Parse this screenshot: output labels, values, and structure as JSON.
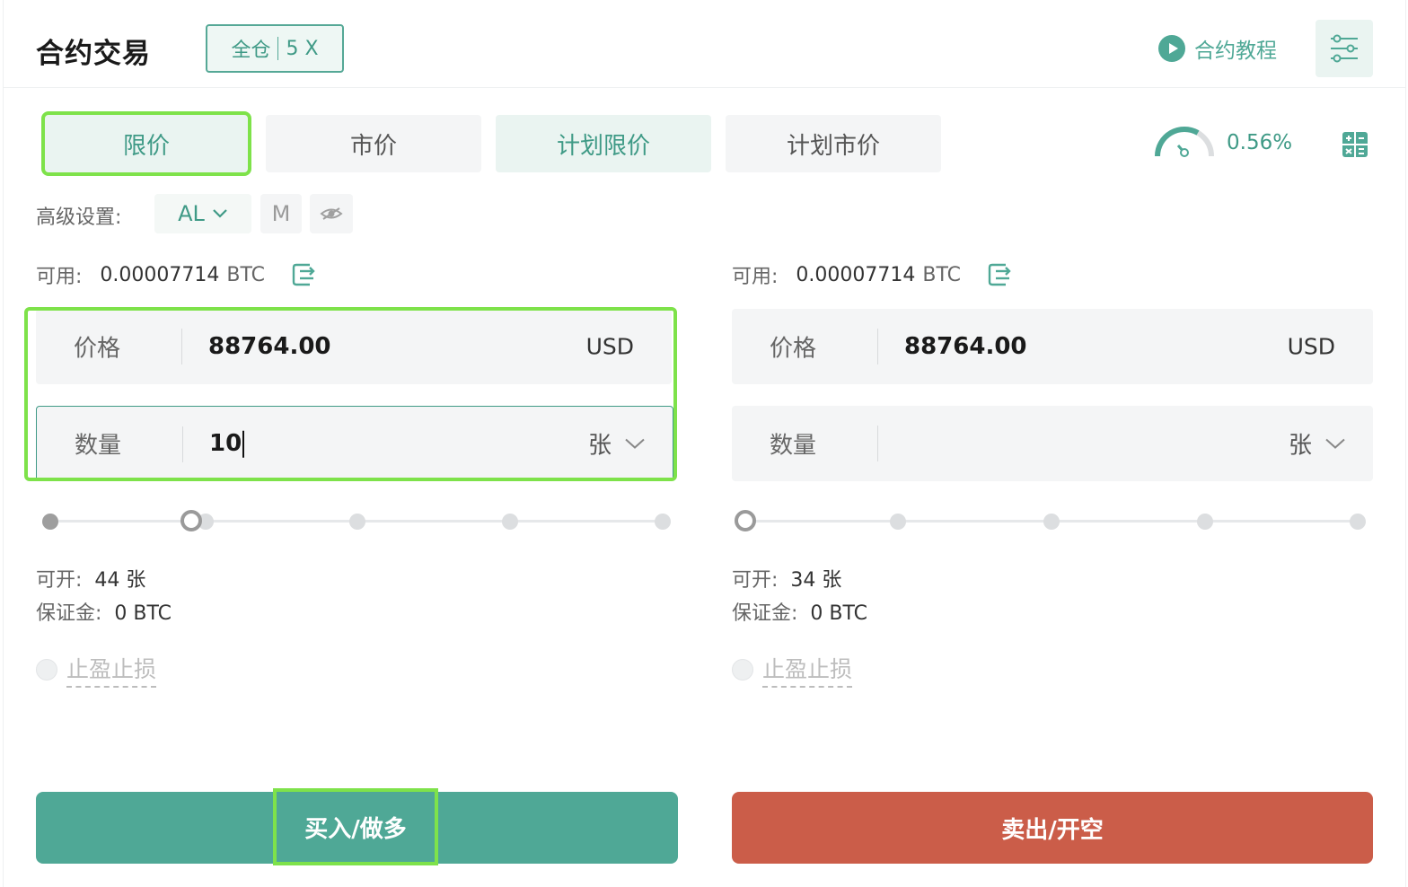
{
  "header": {
    "title": "合约交易",
    "margin_mode": "全仓",
    "leverage": "5 X",
    "tutorial_label": "合约教程"
  },
  "order_tabs": [
    {
      "label": "限价",
      "active": true
    },
    {
      "label": "市价",
      "active": false
    },
    {
      "label": "计划限价",
      "active": false
    },
    {
      "label": "计划市价",
      "active": false
    }
  ],
  "fee_gauge": {
    "value": "0.56%"
  },
  "advanced": {
    "label": "高级设置:",
    "al_label": "AL",
    "m_label": "M"
  },
  "buy_side": {
    "available_label": "可用:",
    "available_value": "0.00007714",
    "available_unit": "BTC",
    "price_label": "价格",
    "price_value": "88764.00",
    "price_unit": "USD",
    "qty_label": "数量",
    "qty_value": "10",
    "qty_unit": "张",
    "slider_level": 0.25,
    "can_open_label": "可开:",
    "can_open_value": "44 张",
    "margin_label": "保证金:",
    "margin_value": "0 BTC",
    "tpsl_label": "止盈止损",
    "button_label": "买入/做多"
  },
  "sell_side": {
    "available_label": "可用:",
    "available_value": "0.00007714",
    "available_unit": "BTC",
    "price_label": "价格",
    "price_value": "88764.00",
    "price_unit": "USD",
    "qty_label": "数量",
    "qty_value": "",
    "qty_unit": "张",
    "slider_level": 0,
    "can_open_label": "可开:",
    "can_open_value": "34 张",
    "margin_label": "保证金:",
    "margin_value": "0 BTC",
    "tpsl_label": "止盈止损",
    "button_label": "卖出/开空"
  },
  "colors": {
    "accent": "#4fa896",
    "buy": "#4fa896",
    "sell": "#cb5d49",
    "highlight": "#7ee24a"
  },
  "icons": {
    "tutorial": "play-circle-icon",
    "settings": "sliders-icon",
    "gauge": "speedometer-icon",
    "calculator": "calculator-icon",
    "transfer": "transfer-icon",
    "eye": "eye-off-icon"
  }
}
